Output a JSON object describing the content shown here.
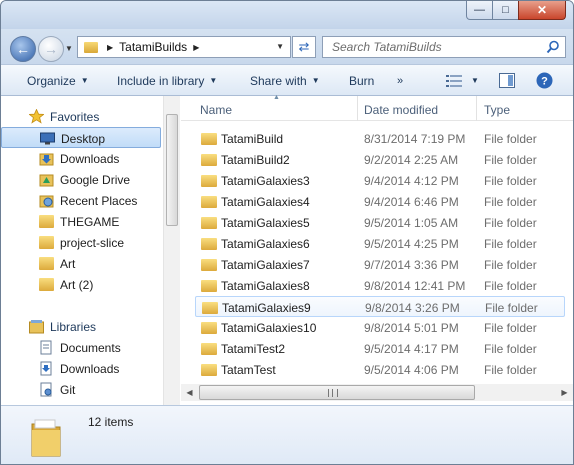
{
  "address": {
    "crumb": "TatamiBuilds"
  },
  "search": {
    "placeholder": "Search TatamiBuilds"
  },
  "toolbar": {
    "organize": "Organize",
    "include": "Include in library",
    "share": "Share with",
    "burn": "Burn",
    "more": "»"
  },
  "nav": {
    "favorites_label": "Favorites",
    "libraries_label": "Libraries",
    "favorites": [
      {
        "label": "Desktop",
        "icon": "desktop-icon"
      },
      {
        "label": "Downloads",
        "icon": "downloads-folder-icon"
      },
      {
        "label": "Google Drive",
        "icon": "google-drive-icon"
      },
      {
        "label": "Recent Places",
        "icon": "recent-places-icon"
      },
      {
        "label": "THEGAME",
        "icon": "folder-icon"
      },
      {
        "label": "project-slice",
        "icon": "folder-icon"
      },
      {
        "label": "Art",
        "icon": "folder-icon"
      },
      {
        "label": "Art (2)",
        "icon": "folder-icon"
      }
    ],
    "libraries": [
      {
        "label": "Documents",
        "icon": "documents-library-icon"
      },
      {
        "label": "Downloads",
        "icon": "downloads-library-icon"
      },
      {
        "label": "Git",
        "icon": "git-library-icon"
      }
    ]
  },
  "columns": {
    "name": "Name",
    "date": "Date modified",
    "type": "Type"
  },
  "files": [
    {
      "name": "TatamiBuild",
      "date": "8/31/2014 7:19 PM",
      "type": "File folder"
    },
    {
      "name": "TatamiBuild2",
      "date": "9/2/2014 2:25 AM",
      "type": "File folder"
    },
    {
      "name": "TatamiGalaxies3",
      "date": "9/4/2014 4:12 PM",
      "type": "File folder"
    },
    {
      "name": "TatamiGalaxies4",
      "date": "9/4/2014 6:46 PM",
      "type": "File folder"
    },
    {
      "name": "TatamiGalaxies5",
      "date": "9/5/2014 1:05 AM",
      "type": "File folder"
    },
    {
      "name": "TatamiGalaxies6",
      "date": "9/5/2014 4:25 PM",
      "type": "File folder"
    },
    {
      "name": "TatamiGalaxies7",
      "date": "9/7/2014 3:36 PM",
      "type": "File folder"
    },
    {
      "name": "TatamiGalaxies8",
      "date": "9/8/2014 12:41 PM",
      "type": "File folder"
    },
    {
      "name": "TatamiGalaxies9",
      "date": "9/8/2014 3:26 PM",
      "type": "File folder"
    },
    {
      "name": "TatamiGalaxies10",
      "date": "9/8/2014 5:01 PM",
      "type": "File folder"
    },
    {
      "name": "TatamiTest2",
      "date": "9/5/2014 4:17 PM",
      "type": "File folder"
    },
    {
      "name": "TatamTest",
      "date": "9/5/2014 4:06 PM",
      "type": "File folder"
    }
  ],
  "status": {
    "item_count": "12 items"
  },
  "colors": {
    "folder": "#e8c25a",
    "accent": "#2c66b8",
    "selection": "#cce4fb"
  }
}
